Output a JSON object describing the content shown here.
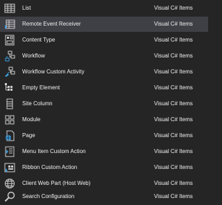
{
  "templates": [
    {
      "name": "List",
      "category": "Visual C# Items",
      "icon": "list-icon",
      "selected": false
    },
    {
      "name": "Remote Event Receiver",
      "category": "Visual C# Items",
      "icon": "remote-event-receiver-icon",
      "selected": true
    },
    {
      "name": "Content Type",
      "category": "Visual C# Items",
      "icon": "content-type-icon",
      "selected": false
    },
    {
      "name": "Workflow",
      "category": "Visual C# Items",
      "icon": "workflow-icon",
      "selected": false
    },
    {
      "name": "Workflow Custom Activity",
      "category": "Visual C# Items",
      "icon": "workflow-custom-activity-icon",
      "selected": false
    },
    {
      "name": "Empty Element",
      "category": "Visual C# Items",
      "icon": "empty-element-icon",
      "selected": false
    },
    {
      "name": "Site Column",
      "category": "Visual C# Items",
      "icon": "site-column-icon",
      "selected": false
    },
    {
      "name": "Module",
      "category": "Visual C# Items",
      "icon": "module-icon",
      "selected": false
    },
    {
      "name": "Page",
      "category": "Visual C# Items",
      "icon": "page-icon",
      "selected": false
    },
    {
      "name": "Menu Item Custom Action",
      "category": "Visual C# Items",
      "icon": "menu-item-custom-action-icon",
      "selected": false
    },
    {
      "name": "Ribbon Custom Action",
      "category": "Visual C# Items",
      "icon": "ribbon-custom-action-icon",
      "selected": false
    },
    {
      "name": "Client Web Part (Host Web)",
      "category": "Visual C# Items",
      "icon": "client-web-part-icon",
      "selected": false
    },
    {
      "name": "Search Configuration",
      "category": "Visual C# Items",
      "icon": "search-configuration-icon",
      "selected": false
    }
  ],
  "colors": {
    "background": "#252526",
    "selected_row": "#3f3f46",
    "text": "#f1f1f1",
    "icon_light": "#d0d0d0",
    "icon_accent": "#3c9ddd"
  }
}
